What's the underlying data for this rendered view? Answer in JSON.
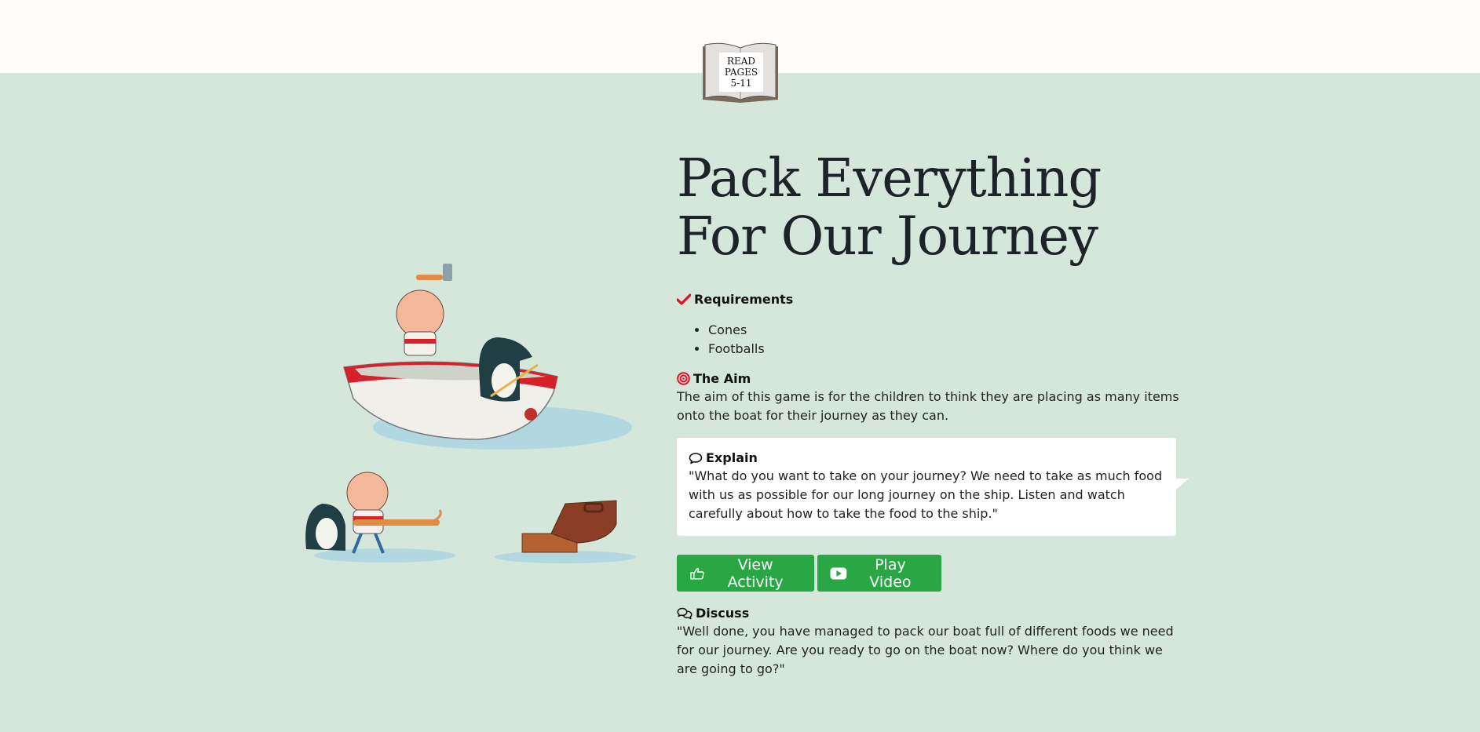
{
  "badge": {
    "line1": "READ",
    "line2": "PAGES",
    "line3": "5-11"
  },
  "title": "Pack Everything For Our Journey",
  "requirements": {
    "heading": "Requirements",
    "items": [
      "Cones",
      "Footballs"
    ]
  },
  "aim": {
    "heading": "The Aim",
    "text": "The aim of this game is for the children to think they are placing as many items onto the boat for their journey as they can."
  },
  "explain": {
    "heading": "Explain",
    "text": "\"What do you want to take on your journey? We need to take as much food with us as possible for our long journey on the ship. Listen and watch carefully about how to take the food to the ship.\""
  },
  "buttons": {
    "view_activity": "View Activity",
    "play_video": "Play Video"
  },
  "discuss": {
    "heading": "Discuss",
    "text": "\"Well done, you have managed to pack our boat full of different foods we need for our journey. Are you ready to go on the boat now? Where do you think we are going to go?\""
  },
  "colors": {
    "background": "#d5e6da",
    "button": "#2aa745",
    "accent_red": "#e0101f"
  },
  "icons": {
    "requirements": "check-icon",
    "aim": "target-icon",
    "explain": "speech-bubble-icon",
    "view_activity": "hand-pointer-icon",
    "play_video": "youtube-play-icon",
    "discuss": "chat-bubbles-icon"
  }
}
